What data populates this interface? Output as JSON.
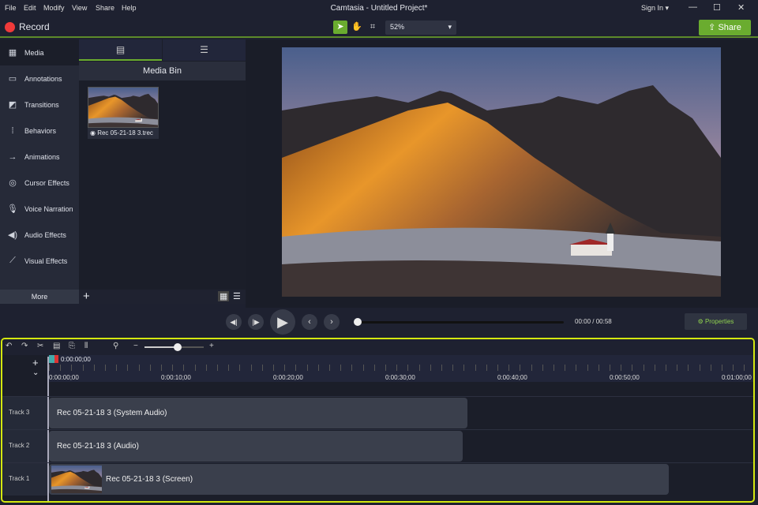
{
  "menu": [
    "File",
    "Edit",
    "Modify",
    "View",
    "Share",
    "Help"
  ],
  "title": "Camtasia - Untitled Project*",
  "sign_in": "Sign In",
  "record": "Record",
  "zoom": "52%",
  "share": "Share",
  "sidebar": {
    "items": [
      {
        "label": "Media",
        "icon": "film-icon"
      },
      {
        "label": "Annotations",
        "icon": "annotation-icon"
      },
      {
        "label": "Transitions",
        "icon": "transition-icon"
      },
      {
        "label": "Behaviors",
        "icon": "behavior-icon"
      },
      {
        "label": "Animations",
        "icon": "animation-icon"
      },
      {
        "label": "Cursor Effects",
        "icon": "cursor-icon"
      },
      {
        "label": "Voice Narration",
        "icon": "microphone-icon"
      },
      {
        "label": "Audio Effects",
        "icon": "speaker-icon"
      },
      {
        "label": "Visual Effects",
        "icon": "wand-icon"
      }
    ],
    "more": "More"
  },
  "bin": {
    "title": "Media Bin",
    "item": "Rec 05-21-18 3.trec"
  },
  "playback": {
    "current": "00:00",
    "total": "00:58",
    "properties": "Properties"
  },
  "timeline": {
    "playhead": "0:00:00;00",
    "ticks": [
      "0:00:00;00",
      "0:00:10;00",
      "0:00:20;00",
      "0:00:30;00",
      "0:00:40;00",
      "0:00:50;00",
      "0:01:00;00"
    ],
    "tracks": [
      {
        "name": "Track 3",
        "clip": "Rec 05-21-18 3 (System Audio)"
      },
      {
        "name": "Track 2",
        "clip": "Rec 05-21-18 3 (Audio)"
      },
      {
        "name": "Track 1",
        "clip": "Rec 05-21-18 3 (Screen)"
      }
    ]
  },
  "colors": {
    "accent": "#6aac2f",
    "highlight": "#d4e80f",
    "record": "#f03a3a"
  }
}
